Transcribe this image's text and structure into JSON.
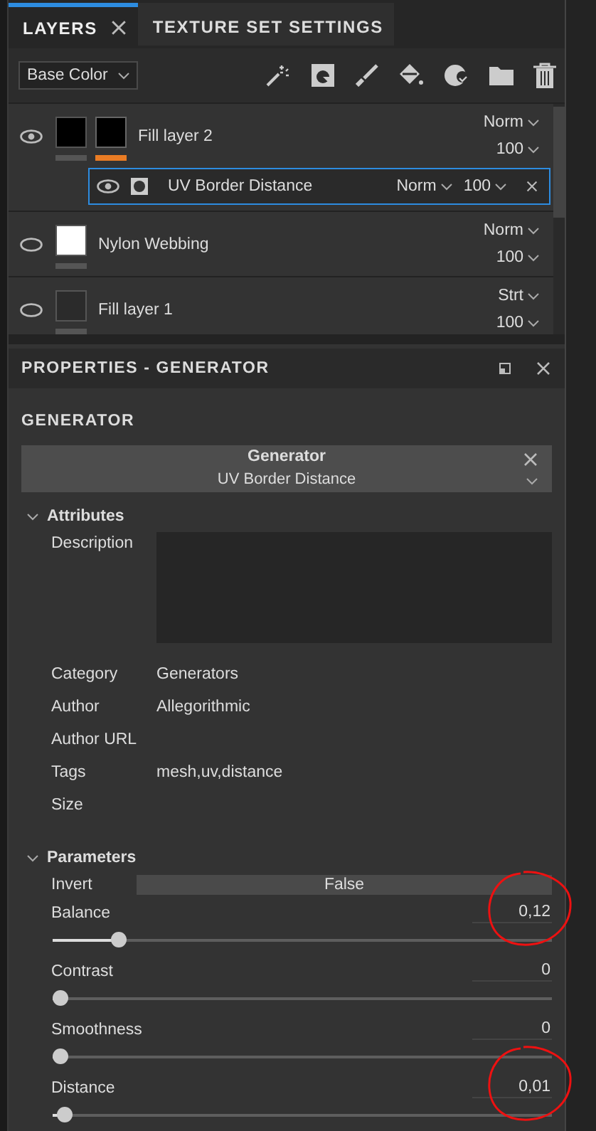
{
  "layers_panel": {
    "tabs": [
      {
        "label": "LAYERS",
        "selected": true,
        "closable": true
      },
      {
        "label": "TEXTURE SET SETTINGS",
        "selected": false,
        "closable": false
      }
    ],
    "channel_select": "Base Color",
    "layers": [
      {
        "name": "Fill layer 2",
        "visible": true,
        "color": "#000000",
        "mask": true,
        "blend": "Norm",
        "opacity": "100",
        "effects": [
          {
            "name": "UV Border Distance",
            "visible": true,
            "selected": true,
            "blend": "Norm",
            "opacity": "100"
          }
        ]
      },
      {
        "name": "Nylon Webbing",
        "visible": false,
        "color": "#ffffff",
        "mask": false,
        "blend": "Norm",
        "opacity": "100"
      },
      {
        "name": "Fill layer 1",
        "visible": false,
        "color": "#2b2b2b",
        "mask": false,
        "blend": "Strt",
        "opacity": "100"
      }
    ]
  },
  "properties": {
    "title": "PROPERTIES - GENERATOR",
    "heading": "GENERATOR",
    "generator": {
      "label": "Generator",
      "value": "UV Border Distance"
    },
    "attributes": {
      "title": "Attributes",
      "expanded": true,
      "rows": [
        {
          "label": "Description",
          "kind": "textbox"
        },
        {
          "label": "Category",
          "value": "Generators",
          "kind": "text"
        },
        {
          "label": "Author",
          "value": "Allegorithmic",
          "kind": "text"
        },
        {
          "label": "Author URL",
          "kind": "text"
        },
        {
          "label": "Tags",
          "value": "mesh,uv,distance",
          "kind": "text"
        },
        {
          "label": "Size",
          "kind": "text"
        }
      ]
    },
    "parameters": {
      "title": "Parameters",
      "expanded": true,
      "items": [
        {
          "label": "Invert",
          "kind": "toggle",
          "value": "False"
        },
        {
          "label": "Balance",
          "kind": "slider",
          "value": "0,12",
          "level": 0.12,
          "circled": true
        },
        {
          "label": "Contrast",
          "kind": "slider",
          "value": "0",
          "level": 0,
          "circled": false
        },
        {
          "label": "Smoothness",
          "kind": "slider",
          "value": "0",
          "level": 0,
          "circled": false
        },
        {
          "label": "Distance",
          "kind": "slider",
          "value": "0,01",
          "level": 0.01,
          "circled": true
        }
      ]
    }
  }
}
